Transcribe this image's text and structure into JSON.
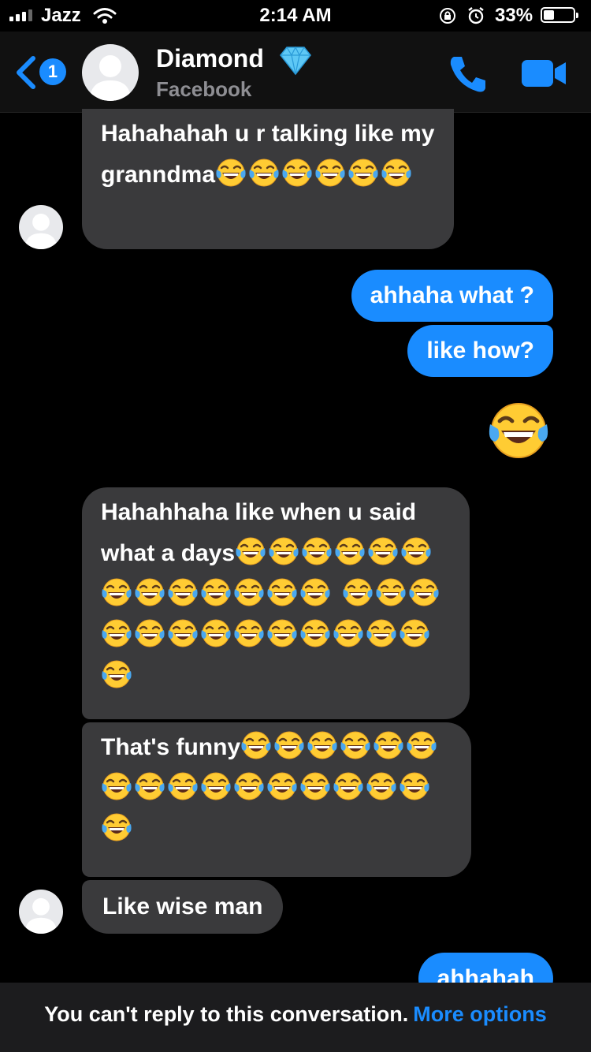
{
  "status_bar": {
    "carrier": "Jazz",
    "time": "2:14 AM",
    "battery_percent": "33%",
    "battery_level": 0.33,
    "icons": [
      "signal-icon",
      "wifi-icon",
      "orientation-lock-icon",
      "alarm-icon",
      "battery-icon"
    ]
  },
  "header": {
    "unread_count": "1",
    "contact_name": "Diamond",
    "contact_subtitle": "Facebook",
    "icons": [
      "back-chevron-icon",
      "avatar-placeholder-icon",
      "diamond-icon",
      "phone-icon",
      "video-camera-icon"
    ]
  },
  "messages": [
    {
      "direction": "incoming",
      "text": "Hahahahah u r talking like my granndma",
      "laugh_emoji_count": 6
    },
    {
      "direction": "outgoing",
      "text": "ahhaha what ?"
    },
    {
      "direction": "outgoing",
      "text": "like how?"
    },
    {
      "direction": "outgoing",
      "text": "",
      "laugh_emoji_count": 1
    },
    {
      "direction": "incoming",
      "text": "Hahahhaha like when u said what a days",
      "laugh_emoji_count": 27
    },
    {
      "direction": "incoming",
      "text": "That's funny",
      "laugh_emoji_count": 17
    },
    {
      "direction": "incoming",
      "text": "Like wise man"
    },
    {
      "direction": "outgoing",
      "text": "ahhahah"
    }
  ],
  "footer": {
    "notice": "You can't reply to this conversation.",
    "action": "More options"
  },
  "colors": {
    "background": "#000000",
    "incoming_bubble": "#3a3a3c",
    "outgoing_bubble": "#1a8cff",
    "accent": "#1a8cff",
    "footer_background": "#1c1c1e"
  }
}
